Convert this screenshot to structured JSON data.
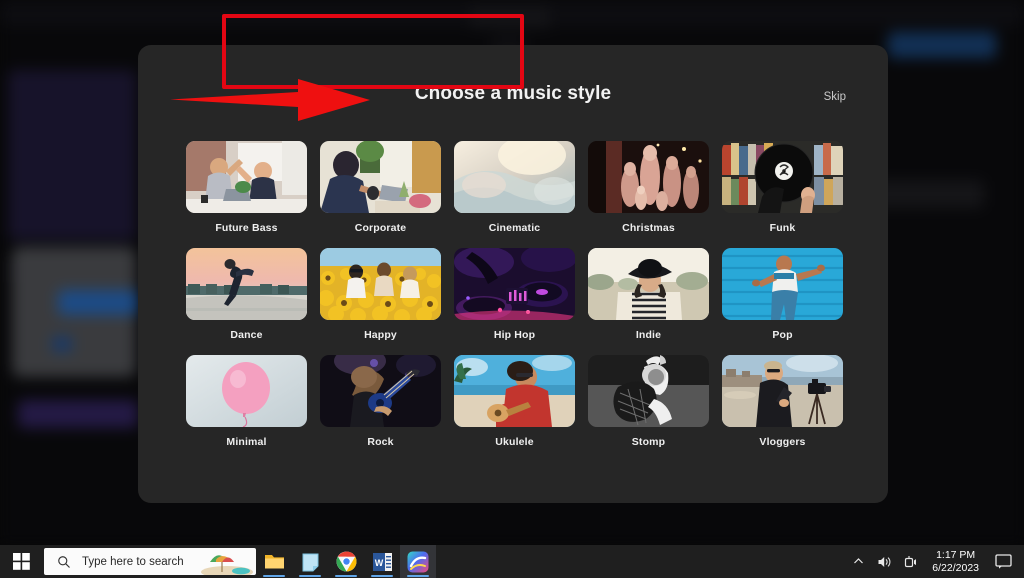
{
  "modal": {
    "title": "Choose a music style",
    "skip_label": "Skip",
    "accent_highlight_color": "#e30613",
    "background_color": "#262626",
    "styles": [
      {
        "label": "Future Bass",
        "thumb": "office-high-five"
      },
      {
        "label": "Corporate",
        "thumb": "woman-laptop-desk"
      },
      {
        "label": "Cinematic",
        "thumb": "soft-blur-bokeh"
      },
      {
        "label": "Christmas",
        "thumb": "nativity-figurines"
      },
      {
        "label": "Funk",
        "thumb": "vinyl-record-store"
      },
      {
        "label": "Dance",
        "thumb": "dancer-sunset-pier"
      },
      {
        "label": "Happy",
        "thumb": "sunflower-field-friends"
      },
      {
        "label": "Hip Hop",
        "thumb": "dj-turntable-purple"
      },
      {
        "label": "Indie",
        "thumb": "woman-hat-field"
      },
      {
        "label": "Pop",
        "thumb": "dancer-blue-wall"
      },
      {
        "label": "Minimal",
        "thumb": "pink-balloon"
      },
      {
        "label": "Rock",
        "thumb": "guitarist-stage"
      },
      {
        "label": "Ukulele",
        "thumb": "ukulele-beach"
      },
      {
        "label": "Stomp",
        "thumb": "bw-dancer-hoodie"
      },
      {
        "label": "Vloggers",
        "thumb": "vlogger-camera-beach"
      }
    ]
  },
  "annotation": {
    "arrow_color": "#ef1010",
    "arrow_direction": "right",
    "highlight_target": "Choose a music style"
  },
  "taskbar": {
    "start_label": "Start",
    "search_placeholder": "Type here to search",
    "apps": [
      {
        "name": "file-explorer"
      },
      {
        "name": "sticky-notes"
      },
      {
        "name": "google-chrome"
      },
      {
        "name": "microsoft-word"
      },
      {
        "name": "filmora-editor"
      }
    ],
    "tray": {
      "show_hidden_label": "Show hidden icons",
      "volume_label": "Volume",
      "network_label": "Network",
      "time": "1:17 PM",
      "date": "6/22/2023",
      "notifications_label": "Notifications"
    }
  }
}
